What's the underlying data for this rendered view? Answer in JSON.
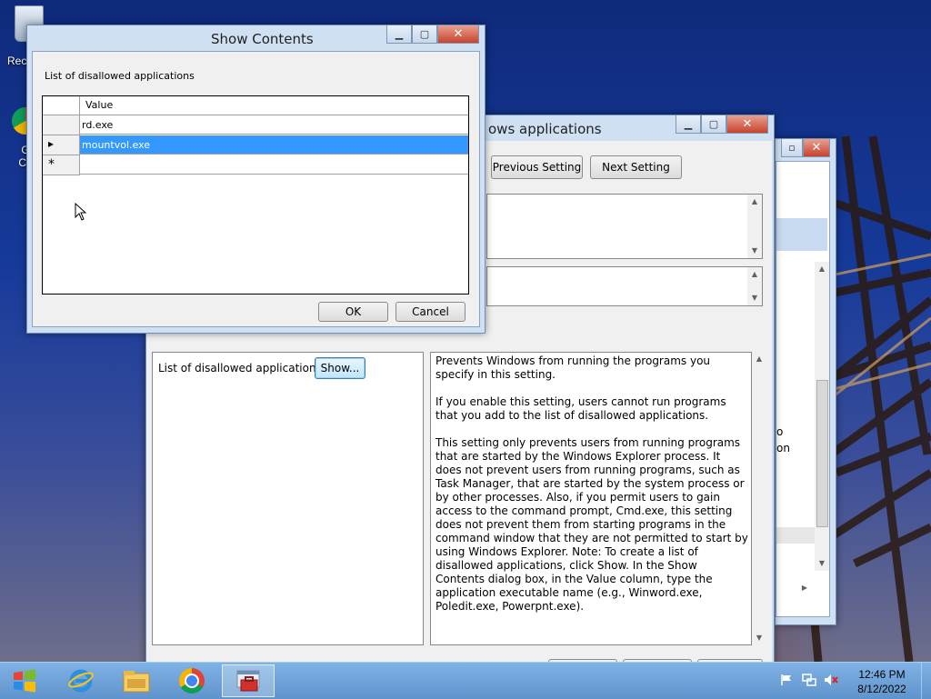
{
  "desktop": {
    "icons": [
      {
        "name": "recycle-bin",
        "label": "Rec"
      },
      {
        "name": "chrome",
        "label": "G\nCh"
      }
    ]
  },
  "gpedit_window": {
    "title_partial": "ows applications",
    "buttons": {
      "previous": "Previous Setting",
      "next": "Next Setting"
    },
    "options_label": "List of disallowed applications",
    "show_button": "Show...",
    "help_text": "Prevents Windows from running the programs you specify in this setting.\n\nIf you enable this setting, users cannot run programs that you add to the list of disallowed applications.\n\nThis setting only prevents users from running programs that are started by the Windows Explorer process. It does not prevent users from running programs, such as Task Manager, that are started by the system process or by other processes. Also, if you permit users to gain access to the command prompt, Cmd.exe, this setting does not prevent them from starting programs in the command window that they are not permitted to start by using Windows Explorer. Note: To create a list of disallowed applications, click Show. In the Show Contents dialog box, in the Value column, type the application executable name (e.g., Winword.exe, Poledit.exe, Powerpnt.exe)."
  },
  "back_window": {
    "fragments": [
      "o",
      "on"
    ]
  },
  "show_contents": {
    "title": "Show Contents",
    "label": "List of disallowed applications",
    "column_header": "Value",
    "rows": [
      {
        "marker": "",
        "value": "rd.exe"
      },
      {
        "marker": "▸",
        "value": "mountvol.exe"
      },
      {
        "marker": "*",
        "value": ""
      }
    ],
    "ok": "OK",
    "cancel": "Cancel"
  },
  "taskbar": {
    "time": "12:46 PM",
    "date": "8/12/2022",
    "apps": [
      "start",
      "internet-explorer",
      "file-explorer",
      "chrome",
      "group-policy-editor"
    ]
  },
  "colors": {
    "selection": "#3399ff",
    "taskbar": "#6a9fd6",
    "window_frame": "#cfe0f3"
  }
}
